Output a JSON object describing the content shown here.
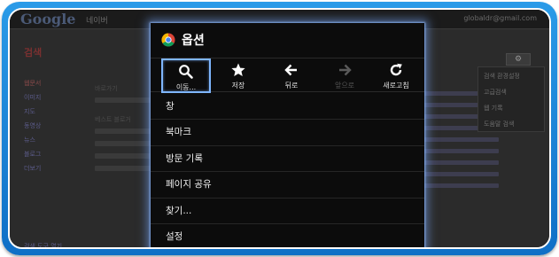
{
  "background": {
    "logo": "Google",
    "search_text": "네이버",
    "account": "globaldr@gmail.com",
    "left_title": "검색",
    "left_items": [
      "웹문서",
      "이미지",
      "지도",
      "동영상",
      "뉴스",
      "블로그",
      "더보기"
    ],
    "left_bottom": [
      "검색 도구 열기"
    ],
    "side_items": [
      "검색 환경설정",
      "고급검색",
      "웹 기록",
      "도움말 검색"
    ],
    "middle_heads": [
      "바로가기",
      "베스트 블로거"
    ]
  },
  "menu": {
    "title": "옵션",
    "toolbar": [
      {
        "label": "이동...",
        "icon": "search-icon",
        "enabled": true,
        "selected": true
      },
      {
        "label": "저장",
        "icon": "star-icon",
        "enabled": true,
        "selected": false
      },
      {
        "label": "뒤로",
        "icon": "arrow-left-icon",
        "enabled": true,
        "selected": false
      },
      {
        "label": "앞으로",
        "icon": "arrow-right-icon",
        "enabled": false,
        "selected": false
      },
      {
        "label": "새로고침",
        "icon": "refresh-icon",
        "enabled": true,
        "selected": false
      }
    ],
    "items": [
      "창",
      "북마크",
      "방문 기록",
      "페이지 공유",
      "찾기...",
      "설정"
    ]
  },
  "colors": {
    "frame_blue": "#1a86d8",
    "menu_bg": "#0c0c0c",
    "selection_outline": "#7fb6ff"
  }
}
